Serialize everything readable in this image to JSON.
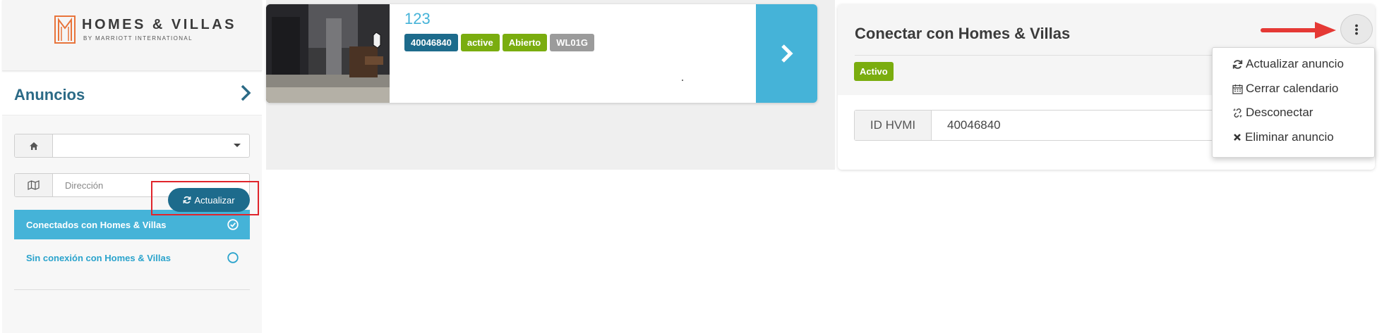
{
  "brand": {
    "title": "HOMES & VILLAS",
    "subtitle": "BY MARRIOTT INTERNATIONAL"
  },
  "sidebar": {
    "title": "Anuncios",
    "property_select": {
      "value": ""
    },
    "address_input": {
      "placeholder": "Dirección",
      "value": ""
    },
    "filters": [
      {
        "label": "Conectados con Homes & Villas",
        "selected": true
      },
      {
        "label": "Sin conexión con Homes & Villas",
        "selected": false
      }
    ],
    "refresh_label": "Actualizar"
  },
  "listing": {
    "name": "123",
    "badges": [
      "40046840",
      "active",
      "Abierto",
      "WL01G"
    ]
  },
  "detail": {
    "title": "Conectar con Homes & Villas",
    "status": "Activo",
    "id_label": "ID HVMI",
    "id_value": "40046840"
  },
  "menu": {
    "items": [
      {
        "label": "Actualizar anuncio",
        "icon": "refresh-icon"
      },
      {
        "label": "Cerrar calendario",
        "icon": "calendar-icon"
      },
      {
        "label": "Desconectar",
        "icon": "unlink-icon"
      },
      {
        "label": "Eliminar anuncio",
        "icon": "close-icon"
      }
    ]
  },
  "colors": {
    "accent": "#45b3d8",
    "primary_dark": "#1d6b8c",
    "success": "#7aad0f",
    "muted_badge": "#9b9b9b",
    "highlight": "#e0242b",
    "brand_orange": "#e8743b"
  }
}
